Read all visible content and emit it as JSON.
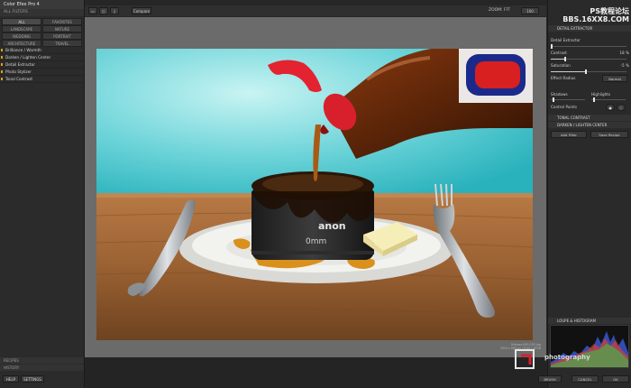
{
  "app": {
    "title": "Color Efex Pro 4"
  },
  "left": {
    "header": "ALL FILTERS",
    "categories": [
      "ALL",
      "FAVORITES",
      "LANDSCAPE",
      "NATURE",
      "WEDDING",
      "PORTRAIT",
      "ARCHITECTURE",
      "TRAVEL"
    ],
    "filters": [
      "Brilliance / Warmth",
      "Darken / Lighten Center",
      "Detail Extractor",
      "Photo Stylizer",
      "Tonal Contrast"
    ],
    "recipes_label": "RECIPES",
    "history_label": "HISTORY",
    "help_label": "HELP",
    "settings_label": "SETTINGS"
  },
  "toolbar": {
    "compare_label": "Compare",
    "zoom_text": "ZOOM: FIT",
    "zoom_value": "100"
  },
  "image_info": {
    "line1": "Mimosa IMG.CR2.jpg",
    "line2": "1024 x 683 px | 8 bit | sRGB"
  },
  "right": {
    "section_title": "DETAIL EXTRACTOR",
    "sliders": [
      {
        "label": "Detail Extractor",
        "value": "",
        "fraction": 0.0
      },
      {
        "label": "Contrast",
        "value": "18 %",
        "fraction": 0.18
      },
      {
        "label": "Saturation",
        "value": "-5 %",
        "fraction": 0.45
      }
    ],
    "effect_radius_label": "Effect Radius",
    "effect_radius_value": "Normal",
    "shadows_label": "Shadows",
    "highlights_label": "Highlights",
    "control_points_label": "Control Points",
    "stack": [
      "TONAL CONTRAST",
      "DARKEN / LIGHTEN CENTER"
    ],
    "add_filter_label": "Add Filter",
    "save_recipe_label": "Save Recipe",
    "histogram_label": "LOUPE & HISTOGRAM",
    "brush_label": "BRUSH",
    "cancel_label": "CANCEL",
    "ok_label": "OK"
  },
  "watermark": {
    "line1": "PS教程论坛",
    "line2": "BBS.16XX8.COM",
    "brand": "photography"
  },
  "colors": {
    "accent": "#d9a21c",
    "sky": "#5fd0d6",
    "table": "#8b5a2b",
    "syrup": "#3a1a08",
    "cap": "#d8202c"
  }
}
